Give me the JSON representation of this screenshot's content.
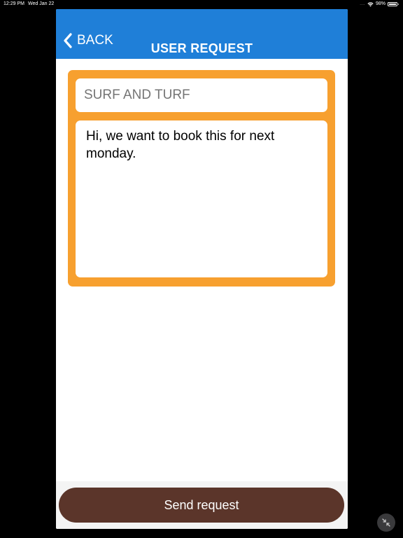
{
  "status_bar": {
    "time": "12:29 PM",
    "date": "Wed Jan 22",
    "signal_dots": "....",
    "battery_percent": "98%",
    "battery_level": 0.98,
    "wifi_icon": "wifi-icon",
    "battery_icon": "battery-icon"
  },
  "nav": {
    "back_label": "BACK",
    "back_icon": "chevron-left-icon",
    "title": "USER REQUEST",
    "background_color": "#1f7fd8"
  },
  "form": {
    "subject_value": "",
    "subject_placeholder": "SURF AND TURF",
    "message_value": "Hi, we want to book this for next monday.",
    "card_color": "#f7a02f"
  },
  "actions": {
    "send_label": "Send request",
    "send_color": "#5b352a",
    "minimize_icon": "minimize-icon"
  }
}
